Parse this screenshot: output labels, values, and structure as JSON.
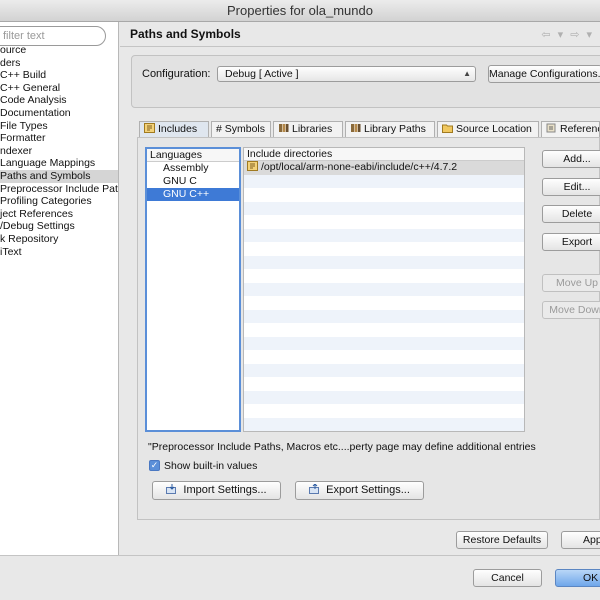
{
  "window": {
    "title": "Properties for ola_mundo"
  },
  "filter": {
    "placeholder": "filter text"
  },
  "tree": [
    "ource",
    "ders",
    "C++ Build",
    "C++ General",
    "Code Analysis",
    "Documentation",
    "File Types",
    "Formatter",
    "ndexer",
    "Language Mappings",
    "Paths and Symbols",
    "Preprocessor Include Pat",
    "Profiling Categories",
    "ject References",
    "/Debug Settings",
    "k Repository",
    "iText"
  ],
  "tree_selected_index": 10,
  "header": {
    "title": "Paths and Symbols",
    "nav": "⇦ ▾ ⇨ ▾"
  },
  "config": {
    "label": "Configuration:",
    "value": "Debug  [ Active ]",
    "manage_button": "Manage Configurations..."
  },
  "tabs": [
    {
      "label": "Includes",
      "icon": "includes-icon"
    },
    {
      "label": "# Symbols",
      "icon": ""
    },
    {
      "label": "Libraries",
      "icon": "libraries-icon"
    },
    {
      "label": "Library Paths",
      "icon": "library-paths-icon"
    },
    {
      "label": "Source Location",
      "icon": "source-location-icon"
    },
    {
      "label": "References",
      "icon": "references-icon"
    }
  ],
  "languages": {
    "header": "Languages",
    "items": [
      "Assembly",
      "GNU C",
      "GNU C++"
    ],
    "selected_index": 2
  },
  "include_dirs": {
    "header": "Include directories",
    "rows": [
      "/opt/local/arm-none-eabi/include/c++/4.7.2"
    ]
  },
  "side_buttons": {
    "add": "Add...",
    "edit": "Edit...",
    "delete": "Delete",
    "export": "Export",
    "move_up": "Move Up",
    "move_down": "Move Down"
  },
  "note": "\"Preprocessor Include Paths, Macros etc....perty page may define additional entries",
  "show_builtin": {
    "label": "Show built-in values",
    "checked": true
  },
  "import_settings": "Import Settings...",
  "export_settings": "Export Settings...",
  "restore_defaults": "Restore Defaults",
  "apply": "Apply",
  "cancel": "Cancel",
  "ok": "OK",
  "colors": {
    "selection": "#3e7ad6",
    "focus_border": "#5b8fd8"
  }
}
